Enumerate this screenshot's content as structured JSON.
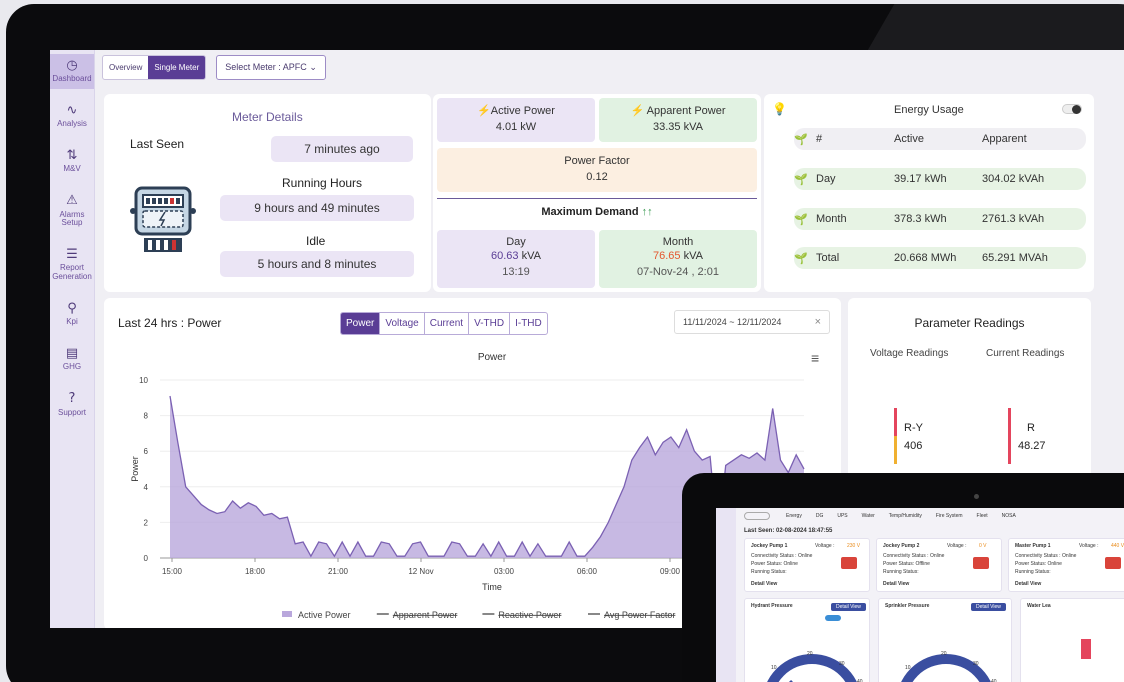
{
  "nav": [
    {
      "icon": "◷",
      "label": "Dashboard",
      "active": true
    },
    {
      "icon": "∿",
      "label": "Analysis"
    },
    {
      "icon": "⇅",
      "label": "M&V"
    },
    {
      "icon": "⚠",
      "label": "Alarms Setup"
    },
    {
      "icon": "☰",
      "label": "Report Generation"
    },
    {
      "icon": "⚲",
      "label": "Kpi"
    },
    {
      "icon": "▤",
      "label": "GHG"
    },
    {
      "icon": "?",
      "label": "Support"
    }
  ],
  "topbar": {
    "overview": "Overview",
    "single_meter": "Single Meter",
    "select_meter": "Select Meter : APFC"
  },
  "meter": {
    "title": "Meter Details",
    "last_seen_label": "Last Seen",
    "last_seen_value": "7 minutes ago",
    "running_label": "Running Hours",
    "running_value": "9 hours and 49 minutes",
    "idle_label": "Idle",
    "idle_value": "5 hours and 8 minutes"
  },
  "power": {
    "active_label": "Active Power",
    "active_value": "4.01 kW",
    "apparent_label": "Apparent Power",
    "apparent_value": "33.35 kVA",
    "pf_label": "Power Factor",
    "pf_value": "0.12",
    "md_label": "Maximum Demand",
    "day_label": "Day",
    "day_value": "60.63",
    "day_unit": "kVA",
    "day_time": "13:19",
    "month_label": "Month",
    "month_value": "76.65",
    "month_unit": "kVA",
    "month_time": "07-Nov-24 , 2:01"
  },
  "energy": {
    "title": "Energy Usage",
    "headers": [
      "#",
      "Active",
      "Apparent"
    ],
    "rows": [
      {
        "label": "Day",
        "active": "39.17 kWh",
        "apparent": "304.02 kVAh"
      },
      {
        "label": "Month",
        "active": "378.3 kWh",
        "apparent": "2761.3 kVAh"
      },
      {
        "label": "Total",
        "active": "20.668 MWh",
        "apparent": "65.291 MVAh"
      }
    ]
  },
  "chart_card": {
    "heading": "Last 24 hrs : Power",
    "tabs": [
      "Power",
      "Voltage",
      "Current",
      "V-THD",
      "I-THD"
    ],
    "date_range": "11/11/2024 ~ 12/11/2024",
    "close": "×",
    "menu": "≡"
  },
  "chart_data": {
    "type": "area",
    "title": "Power",
    "xlabel": "Time",
    "ylabel": "Power",
    "ylim": [
      0,
      10
    ],
    "yticks": [
      0,
      2,
      4,
      6,
      8,
      10
    ],
    "xticks": [
      "15:00",
      "18:00",
      "21:00",
      "12 Nov",
      "03:00",
      "06:00",
      "09:00"
    ],
    "legend": [
      "Active Power",
      "Apparent Power",
      "Reactive Power",
      "Avg Power Factor"
    ],
    "series": [
      {
        "name": "Active Power",
        "values": [
          9.1,
          6.5,
          4.0,
          3.5,
          3.0,
          2.7,
          2.5,
          2.6,
          3.2,
          2.8,
          3.1,
          2.9,
          2.4,
          2.5,
          2.2,
          2.3,
          0.8,
          0.9,
          0.1,
          0.9,
          0.8,
          0.1,
          0.9,
          0.1,
          0.9,
          0.1,
          0.1,
          0.9,
          0.8,
          0.1,
          0.1,
          0.8,
          0.9,
          0.1,
          0.1,
          0.1,
          0.9,
          0.8,
          0.1,
          0.1,
          0.8,
          0.1,
          0.9,
          0.1,
          0.1,
          0.9,
          0.1,
          0.8,
          0.1,
          0.1,
          0.1,
          0.9,
          0.1,
          0.1,
          0.6,
          1.2,
          2.0,
          3.0,
          4.0,
          5.5,
          6.2,
          6.8,
          5.8,
          6.5,
          6.8,
          6.2,
          7.2,
          6.0,
          5.5,
          5.7,
          1.0,
          5.2,
          5.5,
          5.8,
          5.6,
          5.9,
          5.5,
          8.4,
          5.5,
          4.8,
          5.8,
          5.0
        ]
      }
    ]
  },
  "params": {
    "title": "Parameter Readings",
    "voltage_tab": "Voltage Readings",
    "current_tab": "Current Readings",
    "v_label": "R-Y",
    "v_value": "406",
    "c_label": "R",
    "c_value": "48.27"
  },
  "tablet": {
    "last_seen": "Last Seen: 02-08-2024 18:47:55",
    "tabs": [
      "Energy",
      "DG",
      "UPS",
      "Water",
      "Temp/Humidity",
      "Fire System",
      "Fleet",
      "NOSA"
    ],
    "pumps": [
      {
        "name": "Jockey Pump 1",
        "voltage_label": "Voltage :",
        "voltage": "230 V",
        "conn": "Connectivity Status : Online",
        "status": "Power Status: Online",
        "running": "Running Status:",
        "detail": "Detail View"
      },
      {
        "name": "Jockey Pump 2",
        "voltage_label": "Voltage :",
        "voltage": "0 V",
        "conn": "Connectivity Status : Online",
        "status": "Power Status: Offline",
        "running": "Running Status:",
        "detail": "Detail View"
      },
      {
        "name": "Master Pump 1",
        "voltage_label": "Voltage :",
        "voltage": "440 V",
        "conn": "Connectivity Status : Online",
        "status": "Power Status: Online",
        "running": "Running Status:",
        "detail": "Detail View"
      }
    ],
    "hydrant": "Hydrant Pressure",
    "sprinkler": "Sprinkler Pressure",
    "water": "Water Lea",
    "detail_btn": "Detail View",
    "gauge_ticks": [
      "0",
      "10",
      "20",
      "30",
      "40"
    ]
  },
  "colors": {
    "accent": "#5a3d95",
    "area": "#b9a7dc",
    "line": "#7b61b3"
  }
}
